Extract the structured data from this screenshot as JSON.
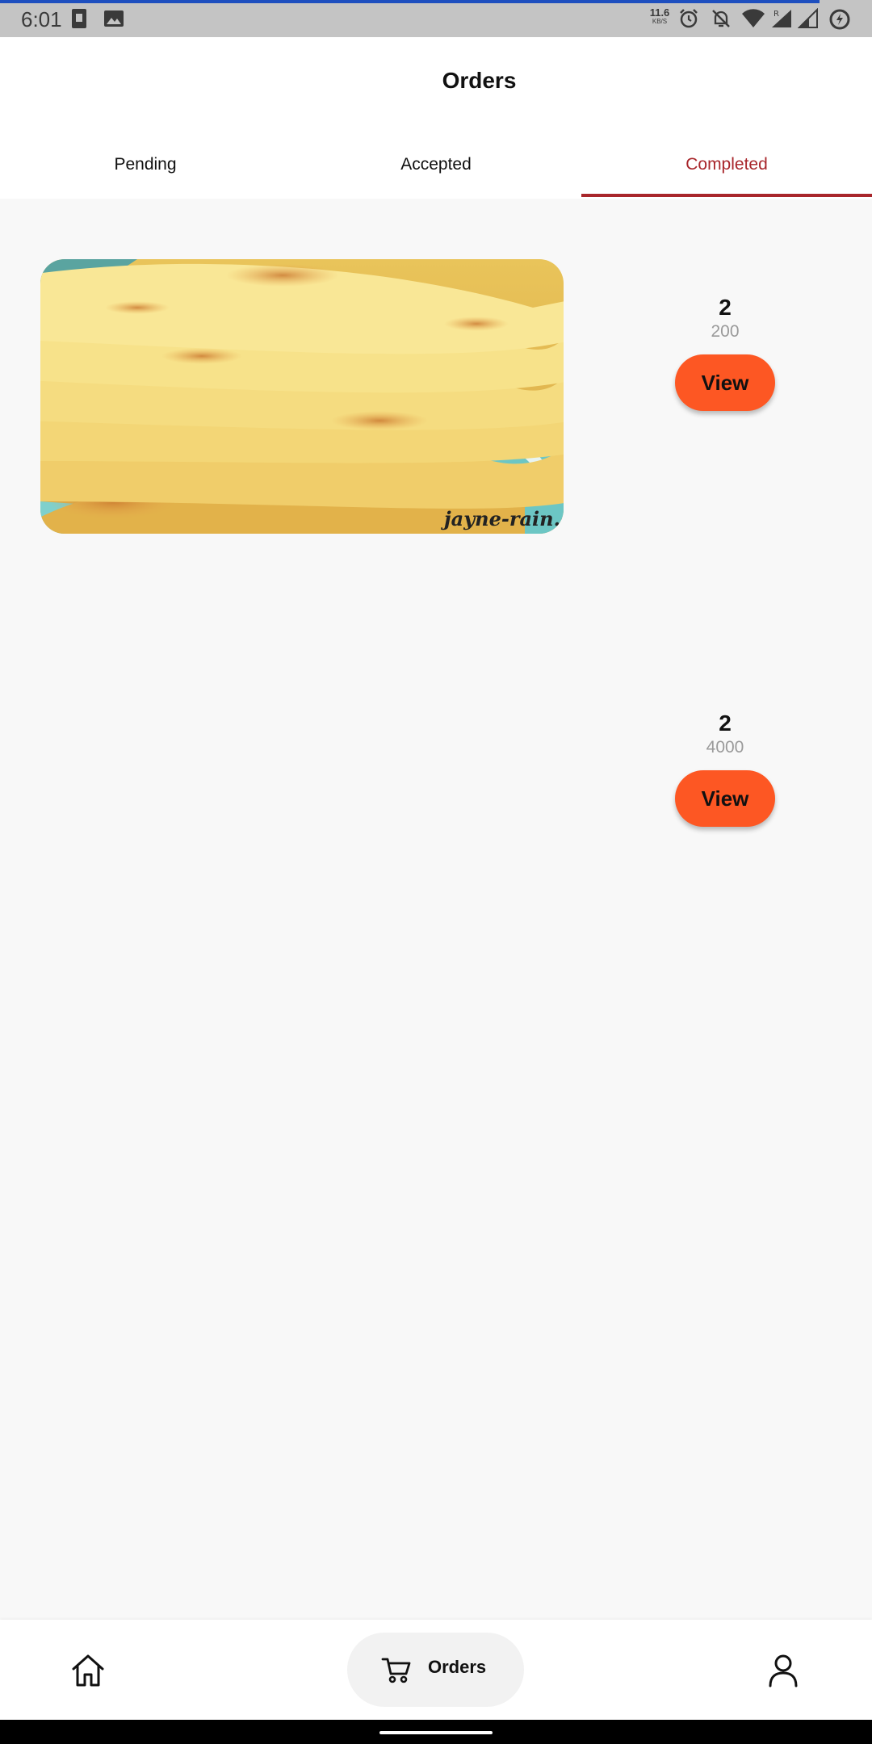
{
  "status_bar": {
    "time": "6:01",
    "net_speed_value": "11.6",
    "net_speed_unit": "KB/S",
    "icons": [
      "sim-card-icon",
      "image-icon",
      "alarm-icon",
      "notifications-off-icon",
      "wifi-icon",
      "signal-icon",
      "signal-roaming-icon",
      "battery-saver-icon"
    ]
  },
  "header": {
    "title": "Orders"
  },
  "tabs": [
    {
      "label": "Pending",
      "active": false
    },
    {
      "label": "Accepted",
      "active": false
    },
    {
      "label": "Completed",
      "active": true
    }
  ],
  "orders": [
    {
      "quantity": "2",
      "amount": "200",
      "button_label": "View",
      "has_image": true,
      "image_watermark": "jayne-rain.c"
    },
    {
      "quantity": "2",
      "amount": "4000",
      "button_label": "View",
      "has_image": false
    }
  ],
  "bottom_nav": {
    "items": [
      {
        "icon": "home-icon",
        "label": "",
        "active": false
      },
      {
        "icon": "cart-icon",
        "label": "Orders",
        "active": true
      },
      {
        "icon": "person-icon",
        "label": "",
        "active": false
      }
    ]
  },
  "colors": {
    "accent": "#a8262b",
    "button": "#fd5723",
    "background": "#f8f8f8",
    "status_bar": "#c4c4c4"
  }
}
